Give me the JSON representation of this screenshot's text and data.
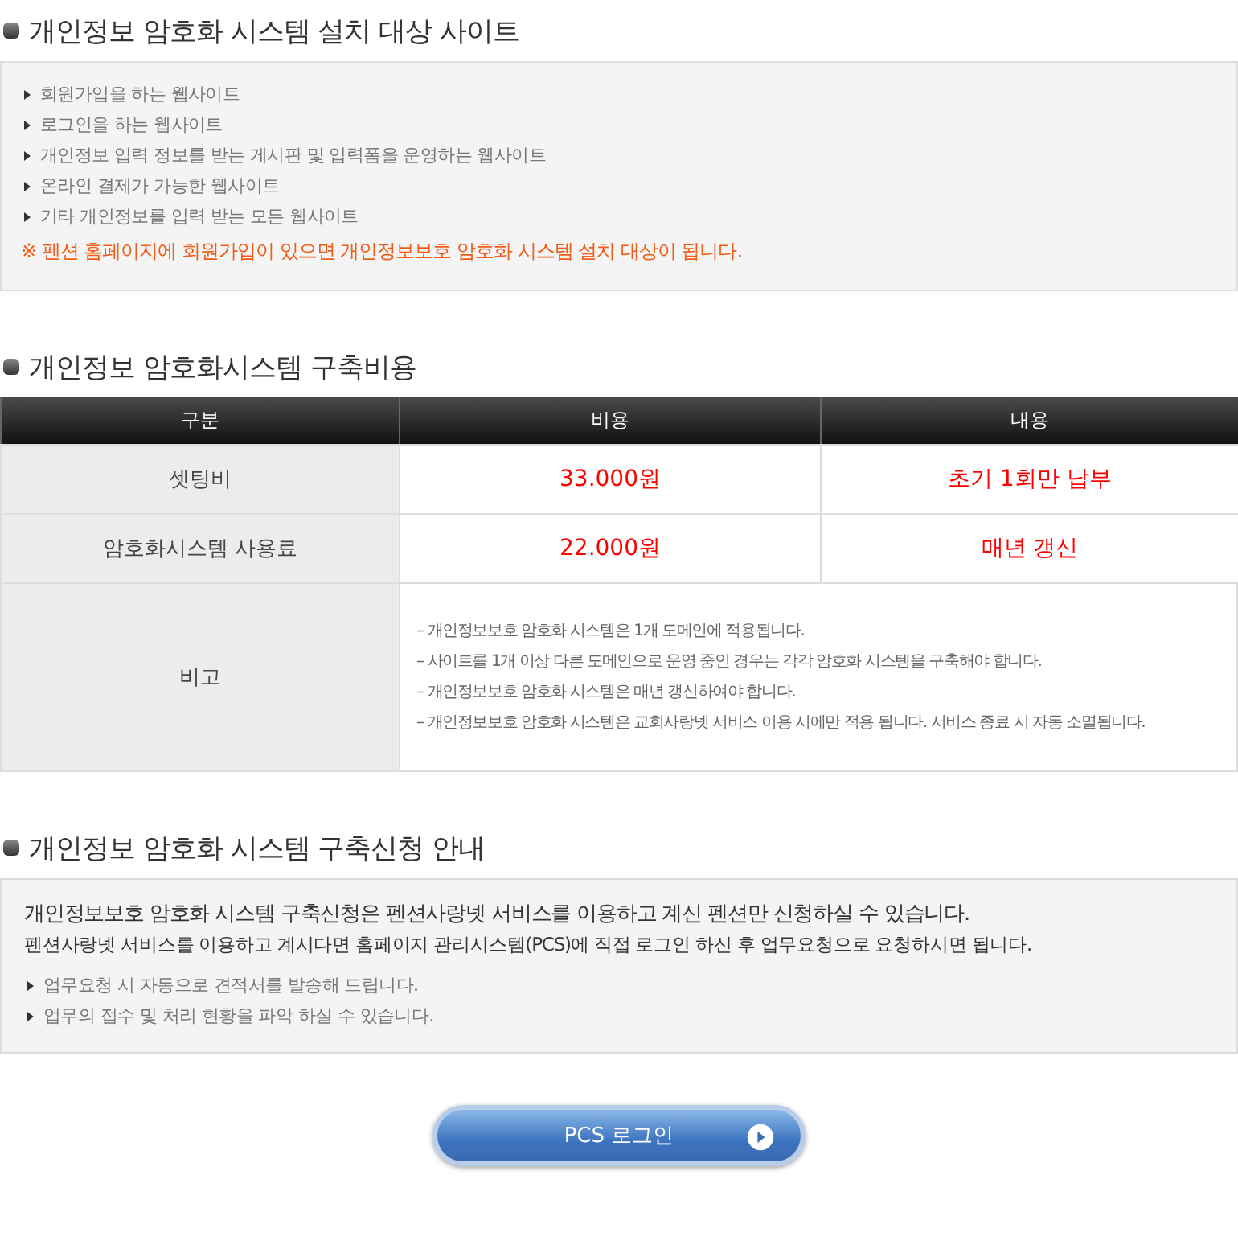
{
  "target_sites": {
    "heading": "개인정보 암호화 시스템 설치 대상 사이트",
    "items": [
      "회원가입을 하는 웹사이트",
      "로그인을 하는 웹사이트",
      "개인정보 입력 정보를 받는 게시판 및 입력폼을 운영하는 웹사이트",
      "온라인 결제가 가능한 웹사이트",
      "기타 개인정보를 입력 받는 모든 웹사이트"
    ],
    "notice": "※ 펜션 홈페이지에 회원가입이 있으면 개인정보보호 암호화 시스템 설치 대상이 됩니다."
  },
  "cost": {
    "heading": "개인정보 암호화시스템 구축비용",
    "columns": [
      "구분",
      "비용",
      "내용"
    ],
    "rows": [
      {
        "kind": "price",
        "cells": [
          "셋팅비",
          "33.000원",
          "초기 1회만 납부"
        ]
      },
      {
        "kind": "price",
        "cells": [
          "암호화시스템 사용료",
          "22.000원",
          "매년 갱신"
        ]
      },
      {
        "kind": "notes",
        "label": "비고",
        "notes": [
          "– 개인정보보호 암호화 시스템은 1개 도메인에 적용됩니다.",
          "– 사이트를 1개 이상 다른 도메인으로 운영 중인 경우는 각각 암호화 시스템을 구축해야 합니다.",
          "– 개인정보보호 암호화 시스템은 매년 갱신하여야 합니다.",
          "– 개인정보보호 암호화 시스템은 교회사랑넷 서비스 이용 시에만 적용 됩니다. 서비스 종료 시 자동 소멸됩니다."
        ]
      }
    ]
  },
  "application": {
    "heading": "개인정보 암호화 시스템 구축신청 안내",
    "lead": "개인정보보호 암호화 시스템 구축신청은 펜션사랑넷 서비스를 이용하고 계신 펜션만 신청하실 수 있습니다.",
    "sub": "펜션사랑넷 서비스를 이용하고 계시다면 홈페이지 관리시스템(PCS)에 직접 로그인 하신 후 업무요청으로 요청하시면 됩니다.",
    "items": [
      "업무요청 시 자동으로 견적서를 발송해 드립니다.",
      "업무의 접수 및 처리 현황을 파악 하실 수 있습니다."
    ]
  },
  "login_button": "PCS 로그인"
}
